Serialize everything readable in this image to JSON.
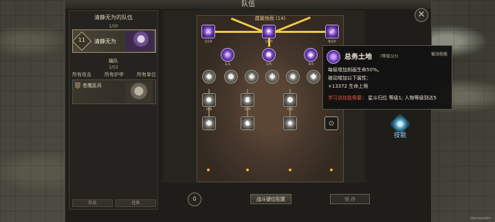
{
  "window": {
    "title": "队伍",
    "close_glyph": "✕"
  },
  "left_panel": {
    "team_title": "清静无为的队伍",
    "team_count": "1/50",
    "hero": {
      "level": "11",
      "name": "清静无为"
    },
    "squad_title": "编队",
    "squad_count": "1/53",
    "filters": [
      "所有攻击",
      "所有护甲",
      "所有单位"
    ],
    "unit": {
      "name": "苍鹰民兵"
    },
    "bottom_tabs": [
      "队伍",
      "任务"
    ]
  },
  "skill_tree": {
    "title": "霞裳快雨 (14)",
    "nodes": {
      "top_left": "1/10",
      "top_center": "1/10",
      "top_right": "6/10",
      "mid_left": "1/1",
      "mid_center": "1/5",
      "mid_right": "3/3",
      "r3_1": "0/9",
      "r3_2": "0/9",
      "r3_3": "0/9",
      "r4_1": "",
      "r4_2": "",
      "r4_3": ""
    }
  },
  "bottom_bar": {
    "points": "0",
    "reset_label": "战斗键位配置",
    "save_label": "保 存"
  },
  "tooltip": {
    "name": "总务土地",
    "level": "(等级3/3)",
    "type": "被动技能",
    "line1": "每级增加刻画生命50%。",
    "line2": "被动增加以下属性：",
    "line3": "+13372 生命上限",
    "req_label": "学习该技能需要：",
    "req_text": "星斗归位 等级1; 人物等级到达5"
  },
  "side_button": {
    "label": "技能"
  },
  "watermark": "tdul.ourslim",
  "colors": {
    "accent_gold": "#f0c945",
    "skill_purple": "#6d3fb0",
    "req_red": "#e0523c"
  }
}
